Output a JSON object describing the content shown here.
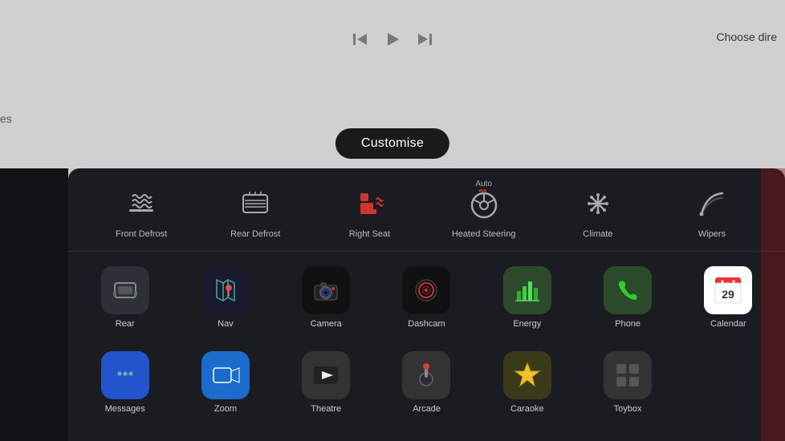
{
  "header": {
    "choose_direction": "Choose dire",
    "top_left": "es",
    "customise_label": "Customise"
  },
  "media": {
    "skip_back": "⏮",
    "play": "▶",
    "skip_forward": "⏭"
  },
  "quick_controls": [
    {
      "id": "front-defrost",
      "label": "Front Defrost",
      "badge": "",
      "icon": "front_defrost"
    },
    {
      "id": "rear-defrost",
      "label": "Rear Defrost",
      "badge": "",
      "icon": "rear_defrost"
    },
    {
      "id": "right-seat",
      "label": "Right Seat",
      "badge": "",
      "icon": "seat_heat"
    },
    {
      "id": "heated-steering",
      "label": "Heated Steering",
      "badge": "Auto",
      "icon": "heated_steering"
    },
    {
      "id": "climate",
      "label": "Climate",
      "badge": "",
      "icon": "climate"
    },
    {
      "id": "wipers",
      "label": "Wipers",
      "badge": "",
      "icon": "wipers"
    }
  ],
  "apps_row1": [
    {
      "id": "rear",
      "label": "Rear",
      "bg": "bg-dark",
      "icon": "rear"
    },
    {
      "id": "nav",
      "label": "Nav",
      "bg": "bg-nav",
      "icon": "nav"
    },
    {
      "id": "camera",
      "label": "Camera",
      "bg": "bg-camera",
      "icon": "camera"
    },
    {
      "id": "dashcam",
      "label": "Dashcam",
      "bg": "bg-dashcam",
      "icon": "dashcam"
    },
    {
      "id": "energy",
      "label": "Energy",
      "bg": "bg-energy",
      "icon": "energy"
    },
    {
      "id": "phone",
      "label": "Phone",
      "bg": "bg-phone",
      "icon": "phone"
    },
    {
      "id": "calendar",
      "label": "Calendar",
      "bg": "bg-calendar",
      "icon": "calendar"
    }
  ],
  "apps_row2": [
    {
      "id": "messages",
      "label": "Messages",
      "bg": "bg-messages",
      "icon": "messages"
    },
    {
      "id": "zoom",
      "label": "Zoom",
      "bg": "bg-zoom",
      "icon": "zoom"
    },
    {
      "id": "theatre",
      "label": "Theatre",
      "bg": "bg-theatre",
      "icon": "theatre"
    },
    {
      "id": "arcade",
      "label": "Arcade",
      "bg": "bg-arcade",
      "icon": "arcade"
    },
    {
      "id": "caraoke",
      "label": "Caraoke",
      "bg": "bg-caraoke",
      "icon": "caraoke"
    },
    {
      "id": "toybox",
      "label": "Toybox",
      "bg": "bg-toybox",
      "icon": "toybox"
    }
  ],
  "calendar_day": "29"
}
